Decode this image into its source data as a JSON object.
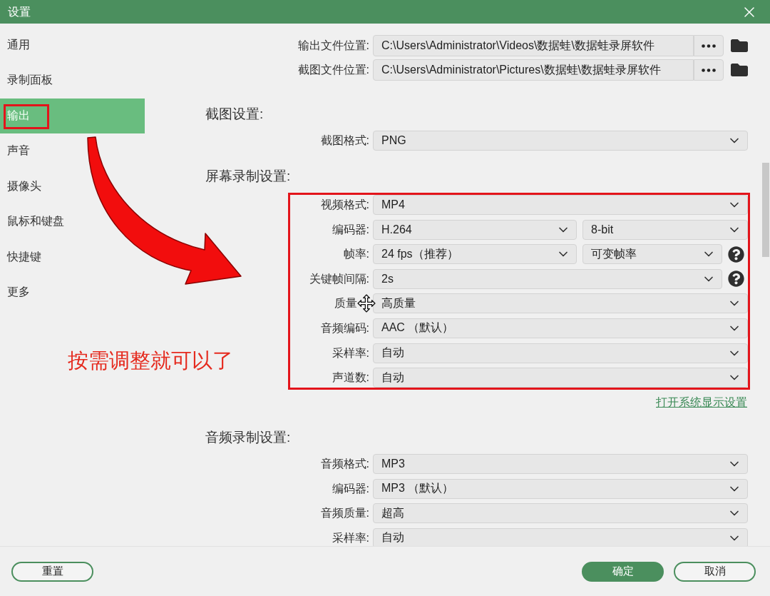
{
  "window": {
    "title": "设置"
  },
  "sidebar": {
    "items": [
      {
        "label": "通用",
        "selected": false,
        "marked": false
      },
      {
        "label": "录制面板",
        "selected": false,
        "marked": false
      },
      {
        "label": "输出",
        "selected": true,
        "marked": true
      },
      {
        "label": "声音",
        "selected": false,
        "marked": false
      },
      {
        "label": "摄像头",
        "selected": false,
        "marked": false
      },
      {
        "label": "鼠标和键盘",
        "selected": false,
        "marked": false
      },
      {
        "label": "快捷键",
        "selected": false,
        "marked": false
      },
      {
        "label": "更多",
        "selected": false,
        "marked": false
      }
    ]
  },
  "locations": [
    {
      "label": "输出文件位置:",
      "value": "C:\\Users\\Administrator\\Videos\\数据蛙\\数据蛙录屏软件"
    },
    {
      "label": "截图文件位置:",
      "value": "C:\\Users\\Administrator\\Pictures\\数据蛙\\数据蛙录屏软件"
    }
  ],
  "sections": [
    {
      "title": "截图设置:",
      "marked": false,
      "rows": [
        {
          "label": "截图格式:",
          "selects": [
            "PNG"
          ],
          "help": false,
          "cursor": false
        }
      ]
    },
    {
      "title": "屏幕录制设置:",
      "marked": true,
      "rows": [
        {
          "label": "视频格式:",
          "selects": [
            "MP4"
          ],
          "help": false,
          "cursor": false
        },
        {
          "label": "编码器:",
          "selects": [
            "H.264",
            "8-bit"
          ],
          "help": false,
          "cursor": false
        },
        {
          "label": "帧率:",
          "selects": [
            "24 fps（推荐）",
            "可变帧率"
          ],
          "help": true,
          "cursor": false
        },
        {
          "label": "关键帧间隔:",
          "selects": [
            "2s"
          ],
          "help": true,
          "cursor": false
        },
        {
          "label": "质量",
          "selects": [
            "高质量"
          ],
          "help": false,
          "cursor": true
        },
        {
          "label": "音频编码:",
          "selects": [
            "AAC （默认）"
          ],
          "help": false,
          "cursor": false
        },
        {
          "label": "采样率:",
          "selects": [
            "自动"
          ],
          "help": false,
          "cursor": false
        },
        {
          "label": "声道数:",
          "selects": [
            "自动"
          ],
          "help": false,
          "cursor": false
        }
      ],
      "link": "打开系统显示设置"
    },
    {
      "title": "音频录制设置:",
      "marked": false,
      "rows": [
        {
          "label": "音频格式:",
          "selects": [
            "MP3"
          ],
          "help": false,
          "cursor": false
        },
        {
          "label": "编码器:",
          "selects": [
            "MP3 （默认）"
          ],
          "help": false,
          "cursor": false
        },
        {
          "label": "音频质量:",
          "selects": [
            "超高"
          ],
          "help": false,
          "cursor": false
        },
        {
          "label": "采样率:",
          "selects": [
            "自动"
          ],
          "help": false,
          "cursor": false
        }
      ]
    }
  ],
  "annotation": {
    "text": "按需调整就可以了",
    "arrow": true
  },
  "buttons": [
    {
      "label": "重置",
      "kind": "outline"
    },
    {
      "label": "确定",
      "kind": "primary"
    },
    {
      "label": "取消",
      "kind": "outline"
    }
  ]
}
